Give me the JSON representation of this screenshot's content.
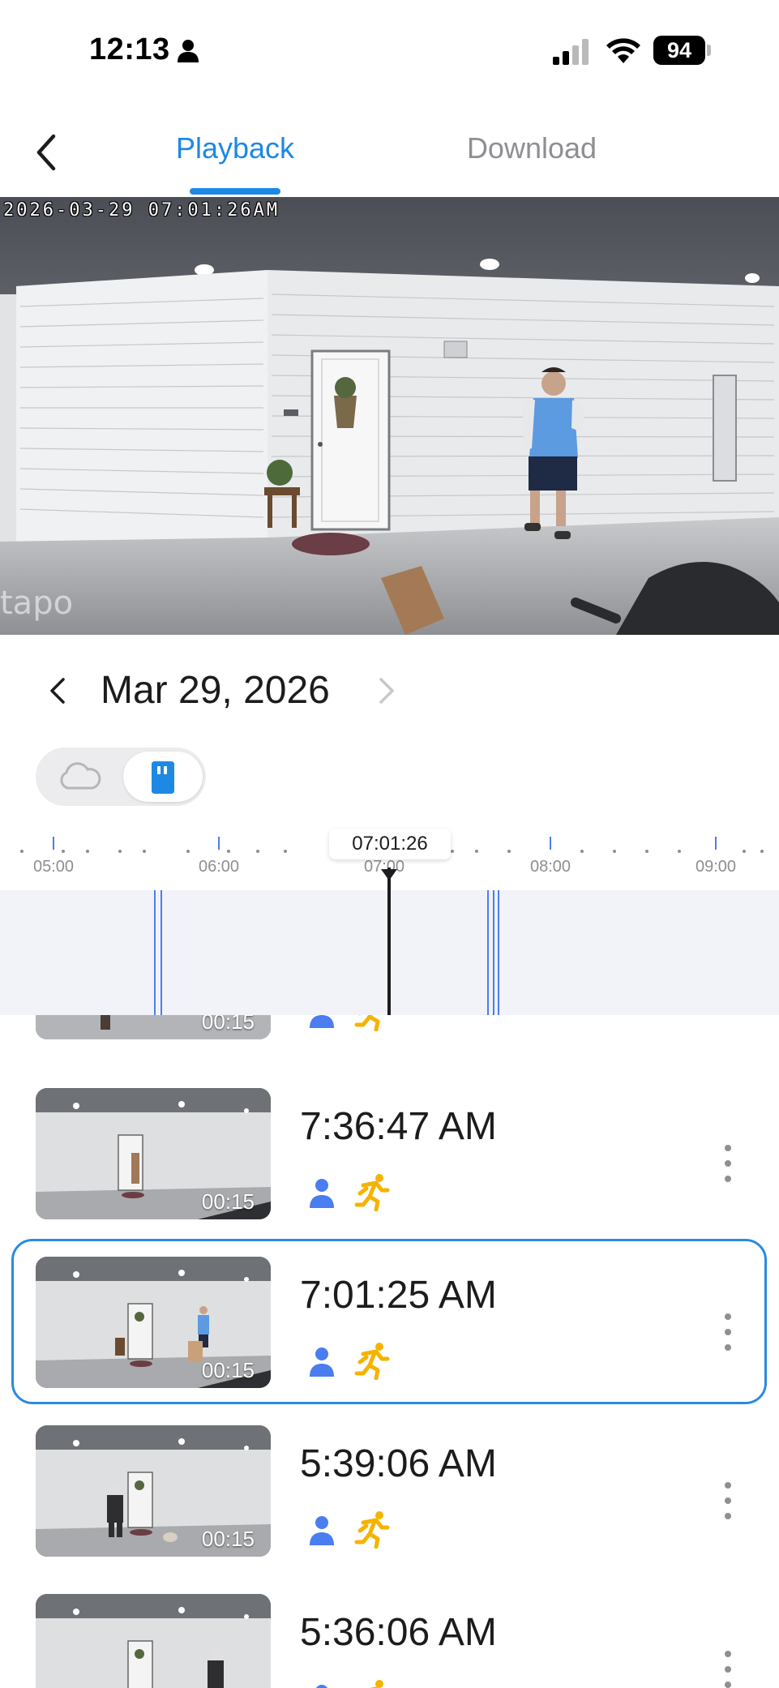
{
  "status_bar": {
    "time": "12:13",
    "battery": "94"
  },
  "header": {
    "tabs": [
      {
        "label": "Playback",
        "active": true
      },
      {
        "label": "Download",
        "active": false
      }
    ]
  },
  "video": {
    "timestamp": "2026-03-29  07:01:26AM",
    "logo": "tapo"
  },
  "date_nav": {
    "date": "Mar 29, 2026"
  },
  "storage_toggle": {
    "options": [
      "cloud",
      "sd-card"
    ],
    "selected": "sd-card"
  },
  "timeline": {
    "cursor_time": "07:01:26",
    "hour_labels": [
      "05:00",
      "06:00",
      "07:00",
      "08:00",
      "09:00"
    ]
  },
  "events": [
    {
      "time": "",
      "duration": "00:15",
      "tags": [
        "person",
        "motion"
      ],
      "selected": false,
      "partial": true
    },
    {
      "time": "7:36:47 AM",
      "duration": "00:15",
      "tags": [
        "person",
        "motion"
      ],
      "selected": false
    },
    {
      "time": "7:01:25 AM",
      "duration": "00:15",
      "tags": [
        "person",
        "motion"
      ],
      "selected": true
    },
    {
      "time": "5:39:06 AM",
      "duration": "00:15",
      "tags": [
        "person",
        "motion"
      ],
      "selected": false
    },
    {
      "time": "5:36:06 AM",
      "duration": "",
      "tags": [
        "person",
        "motion"
      ],
      "selected": false,
      "partial": true
    }
  ],
  "colors": {
    "accent": "#1e88e5",
    "person_icon": "#4a7df0",
    "motion_icon": "#f5b300",
    "clip_marker": "#4e7cf0"
  }
}
